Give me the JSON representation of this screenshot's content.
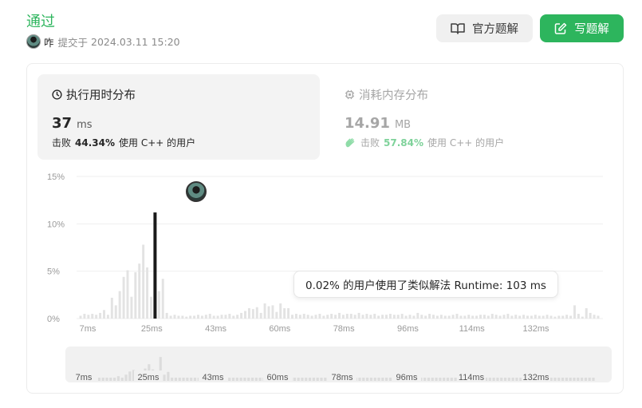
{
  "header": {
    "status": "通过",
    "user": "咋",
    "submitted_label": "提交于",
    "submitted_time": "2024.03.11 15:20"
  },
  "buttons": {
    "official_solution": "官方题解",
    "write_solution": "写题解"
  },
  "runtime": {
    "title": "执行用时分布",
    "value": "37",
    "unit": "ms",
    "beat_label": "击败",
    "beat_pct": "44.34%",
    "beat_suffix": "使用 C++ 的用户"
  },
  "memory": {
    "title": "消耗内存分布",
    "value": "14.91",
    "unit": "MB",
    "beat_label": "击败",
    "beat_pct": "57.84%",
    "beat_suffix": "使用 C++ 的用户"
  },
  "tooltip": "0.02% 的用户使用了类似解法 Runtime: 103 ms",
  "colors": {
    "accent": "#2db55d",
    "bar": "#e3e3e3",
    "highlight": "#1a1a1a"
  },
  "chart_data": {
    "type": "bar",
    "ylabel_ticks": [
      "15%",
      "10%",
      "5%",
      "0%"
    ],
    "ylim": [
      0,
      15
    ],
    "x_tick_labels": [
      "7ms",
      "25ms",
      "43ms",
      "60ms",
      "78ms",
      "96ms",
      "114ms",
      "132ms"
    ],
    "highlight_runtime": "37 ms",
    "highlight_value": 11.2,
    "values": [
      0.3,
      0.5,
      0.4,
      0.5,
      0.4,
      0.6,
      0.9,
      0.4,
      2.2,
      1.4,
      2.9,
      4.4,
      5.1,
      2.3,
      4.9,
      5.8,
      7.8,
      5.4,
      2.3,
      11.2,
      2.9,
      4.2,
      0.6,
      0.3,
      0.4,
      0.3,
      0.3,
      0.2,
      0.3,
      0.3,
      0.4,
      0.3,
      0.4,
      0.5,
      0.3,
      0.3,
      0.4,
      0.4,
      0.5,
      0.3,
      0.4,
      0.6,
      0.8,
      1.1,
      1.0,
      1.2,
      0.6,
      1.6,
      1.3,
      1.4,
      0.7,
      1.6,
      1.1,
      1.1,
      0.4,
      0.5,
      0.4,
      0.5,
      0.4,
      0.3,
      0.4,
      0.5,
      0.3,
      0.4,
      0.5,
      0.4,
      0.6,
      0.4,
      0.5,
      0.5,
      0.4,
      0.6,
      0.4,
      0.5,
      0.4,
      0.5,
      0.3,
      0.4,
      0.4,
      0.5,
      0.4,
      0.4,
      0.5,
      0.3,
      0.4,
      0.3,
      0.6,
      0.4,
      0.3,
      0.5,
      0.4,
      0.3,
      0.4,
      0.3,
      0.3,
      0.4,
      0.5,
      0.3,
      0.3,
      0.4,
      0.3,
      0.3,
      0.4,
      0.4,
      0.3,
      0.5,
      0.4,
      0.3,
      0.4,
      0.5,
      0.3,
      0.4,
      0.3,
      0.4,
      0.3,
      0.3,
      0.4,
      0.3,
      0.3,
      0.4,
      0.3,
      0.2,
      0.3,
      0.3,
      0.4,
      0.3,
      1.4,
      0.5,
      0.2,
      1.1,
      0.6,
      0.4,
      0.3
    ],
    "minimap_ticks": [
      "7ms",
      "25ms",
      "43ms",
      "60ms",
      "78ms",
      "96ms",
      "114ms",
      "132ms"
    ]
  }
}
